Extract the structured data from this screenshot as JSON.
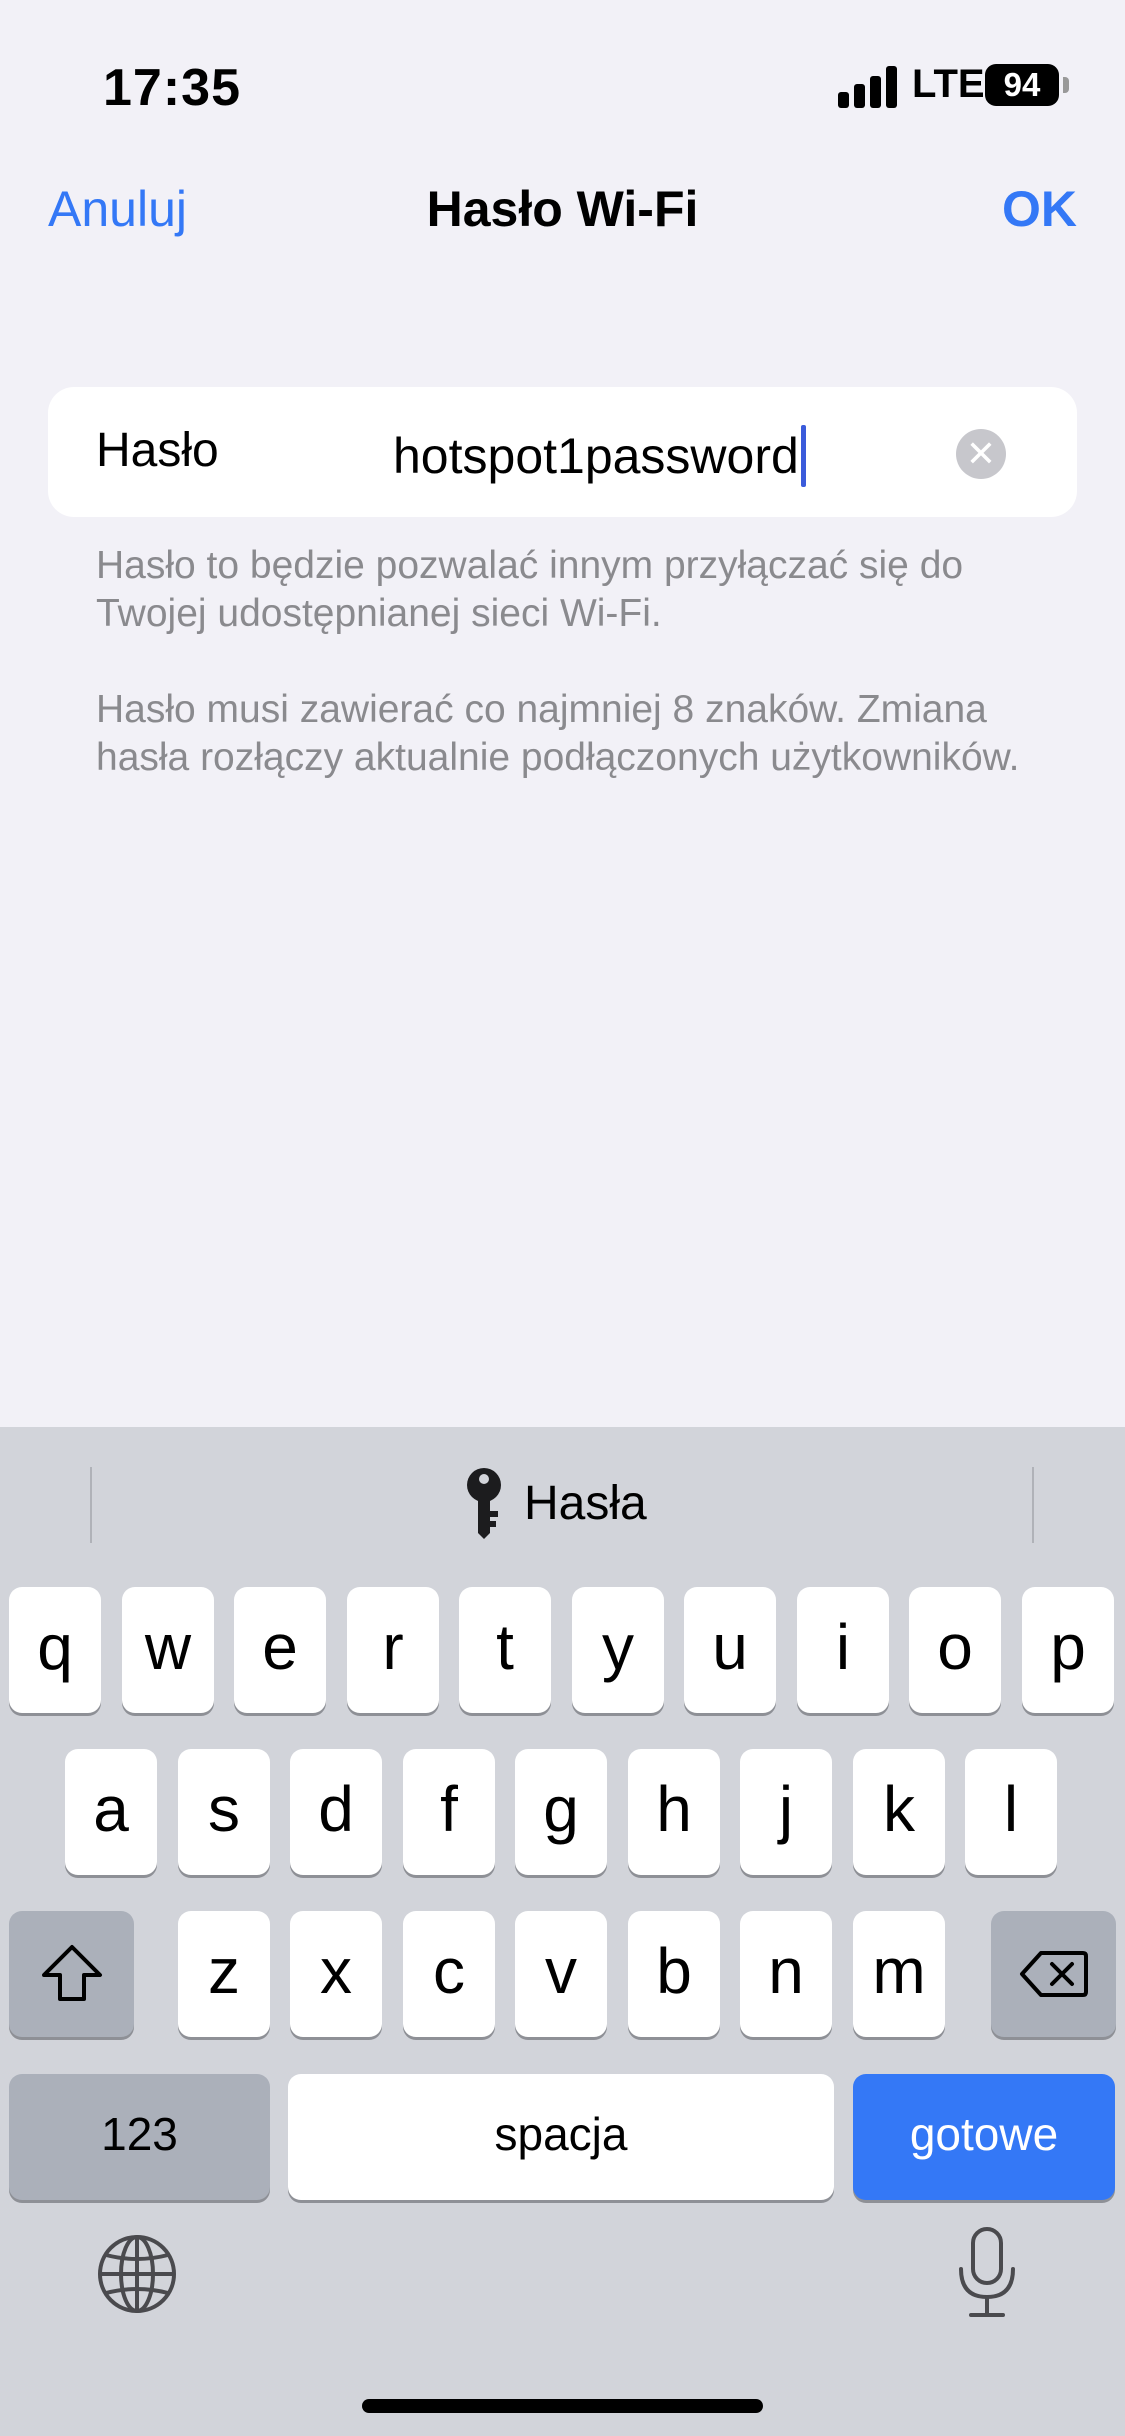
{
  "status": {
    "time": "17:35",
    "network": "LTE",
    "battery": "94"
  },
  "nav": {
    "cancel": "Anuluj",
    "title": "Hasło Wi-Fi",
    "ok": "OK"
  },
  "field": {
    "label": "Hasło",
    "value": "hotspot1password",
    "clear_icon": "clear-icon"
  },
  "notes": [
    "Hasło to będzie pozwalać innym przyłączać się do Twojej udostępnianej sieci Wi-Fi.",
    "Hasło musi zawierać co najmniej 8 znaków. Zmiana hasła rozłączy aktualnie podłączonych użytkowników."
  ],
  "keyboard": {
    "suggestion": "Hasła",
    "row1": [
      "q",
      "w",
      "e",
      "r",
      "t",
      "y",
      "u",
      "i",
      "o",
      "p"
    ],
    "row2": [
      "a",
      "s",
      "d",
      "f",
      "g",
      "h",
      "j",
      "k",
      "l"
    ],
    "row3": [
      "z",
      "x",
      "c",
      "v",
      "b",
      "n",
      "m"
    ],
    "numbers": "123",
    "space": "spacja",
    "done": "gotowe"
  },
  "colors": {
    "accent": "#3478f6",
    "background": "#f2f1f7",
    "keyboard": "#d2d4da"
  }
}
